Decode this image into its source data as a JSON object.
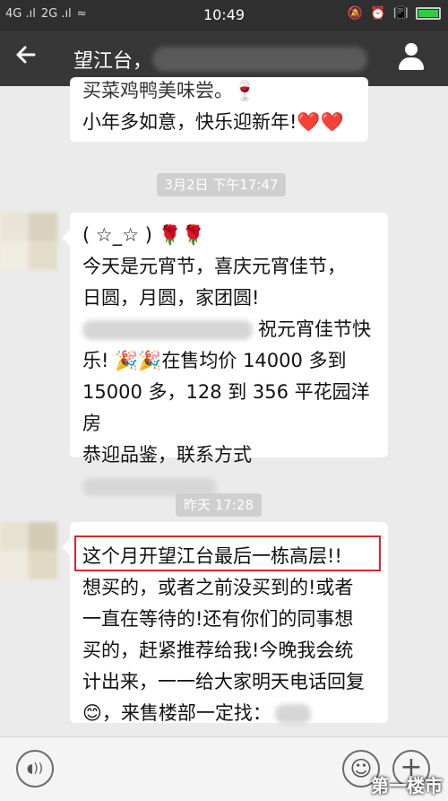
{
  "status_bar": {
    "signal_left": "4G .ıl",
    "signal_right": "2G .ıl",
    "wifi": "≈",
    "time": "10:49",
    "icons": [
      "bell-off-icon",
      "alarm-icon",
      "vibrate-icon",
      "battery-icon"
    ]
  },
  "header": {
    "back_icon": "back-arrow-icon",
    "title": "望江台，",
    "profile_icon": "person-icon"
  },
  "messages": [
    {
      "lines": [
        "买菜鸡鸭美味尝。🍷",
        "小年多如意，快乐迎新年!❤️❤️"
      ]
    },
    {
      "timestamp": "3月2日 下午17:47",
      "lines": [
        "( ☆_☆ ) 🌹🌹",
        "今天是元宵节，喜庆元宵佳节，",
        "日圆，月圆，家团圆!",
        "祝元宵佳节快",
        "乐! 🎉🎉在售均价 14000 多到",
        "15000 多，128 到 356 平花园洋房",
        "恭迎品鉴，联系方式"
      ]
    },
    {
      "timestamp": "昨天 17:28",
      "lines": [
        "这个月开望江台最后一栋高层!!",
        "想买的，或者之前没买到的!或者",
        "一直在等待的!还有你们的同事想",
        "买的，赶紧推荐给我!今晚我会统",
        "计出来，一一给大家明天电话回复",
        "😊，来售楼部一定找："
      ]
    }
  ],
  "input_bar": {
    "voice_icon": "voice-icon",
    "emoji_icon": "emoji-icon",
    "plus_icon": "plus-icon",
    "voice_glyph": "◖))",
    "emoji_glyph": "☺",
    "plus_glyph": "+"
  },
  "watermark": "第一楼市",
  "colors": {
    "title_bar": "#373737",
    "status_bar": "#2f2f2f",
    "background": "#ebebeb",
    "highlight": "#d7262f"
  }
}
